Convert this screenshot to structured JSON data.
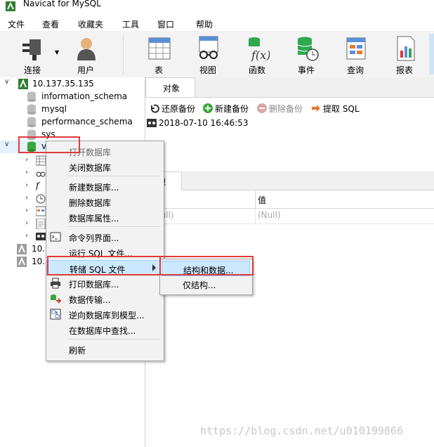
{
  "window": {
    "title": "Navicat for MySQL"
  },
  "menubar": {
    "items": [
      "文件",
      "查看",
      "收藏夹",
      "工具",
      "窗口",
      "帮助"
    ]
  },
  "toolbar": {
    "buttons": [
      {
        "label": "连接",
        "icon": "plug-icon"
      },
      {
        "label": "用户",
        "icon": "user-icon"
      },
      {
        "label": "表",
        "icon": "table-icon"
      },
      {
        "label": "视图",
        "icon": "view-glasses-icon"
      },
      {
        "label": "函数",
        "icon": "function-icon"
      },
      {
        "label": "事件",
        "icon": "event-clock-icon"
      },
      {
        "label": "查询",
        "icon": "query-icon"
      },
      {
        "label": "报表",
        "icon": "report-icon"
      }
    ]
  },
  "tree": {
    "connection": "10.137.35.135",
    "databases": [
      "information_schema",
      "mysql",
      "performance_schema",
      "sys",
      "v"
    ],
    "other_connections": [
      "10.1",
      "10.1"
    ]
  },
  "right": {
    "tab": "对象",
    "toolbar": [
      "还原备份",
      "新建备份",
      "删除备份",
      "提取 SQL"
    ],
    "backup_row": "2018-07-10 16:46:53",
    "lower_tab": "规",
    "grid_header": [
      "",
      "值"
    ],
    "grid_row": [
      "(Null)",
      "(Null)"
    ]
  },
  "context_menu": {
    "items": [
      {
        "label": "打开数据库",
        "disabled": true
      },
      {
        "label": "关闭数据库"
      },
      {
        "label": "新建数据库..."
      },
      {
        "label": "删除数据库"
      },
      {
        "label": "数据库属性..."
      },
      {
        "label": "命令列界面..."
      },
      {
        "label": "运行 SQL 文件..."
      },
      {
        "label": "转储 SQL 文件"
      },
      {
        "label": "打印数据库..."
      },
      {
        "label": "数据传输..."
      },
      {
        "label": "逆向数据库到模型..."
      },
      {
        "label": "在数据库中查找..."
      },
      {
        "label": "刷新"
      }
    ]
  },
  "submenu": {
    "items": [
      "结构和数据...",
      "仅结构..."
    ]
  },
  "watermark": "https://blog.csdn.net/u010199866",
  "colors": {
    "highlight": "#cce8ff",
    "annotation_red": "#e03a3a",
    "db_green": "#3aa83a"
  }
}
